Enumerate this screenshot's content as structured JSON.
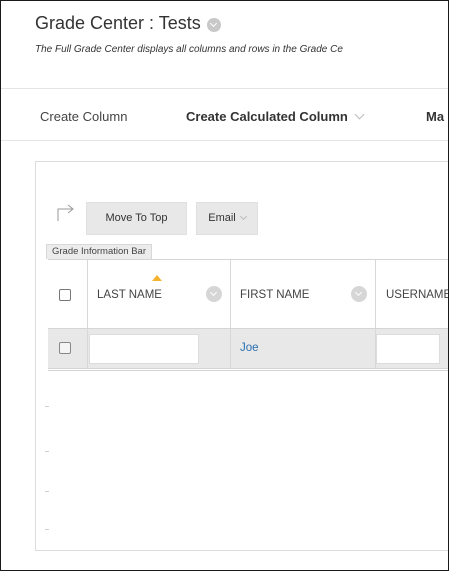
{
  "header": {
    "title": "Grade Center : Tests",
    "description": "The Full Grade Center displays all columns and rows in the Grade Ce"
  },
  "action_bar": {
    "create_column": "Create Column",
    "create_calculated_column": "Create Calculated Column",
    "manage_truncated": "Ma"
  },
  "toolbar": {
    "move_to_top": "Move To Top",
    "email": "Email"
  },
  "info_bar": {
    "label": "Grade Information Bar"
  },
  "table": {
    "columns": [
      {
        "label": "LAST NAME"
      },
      {
        "label": "FIRST NAME"
      },
      {
        "label": "USERNAME"
      }
    ],
    "rows": [
      {
        "last_name": "",
        "first_name": "Joe",
        "username": ""
      }
    ]
  },
  "colors": {
    "link": "#2a6fb0",
    "sort_indicator": "#f3b32f",
    "button_bg": "#e8e8e8",
    "selected_row_bg": "#e8e8e8"
  }
}
